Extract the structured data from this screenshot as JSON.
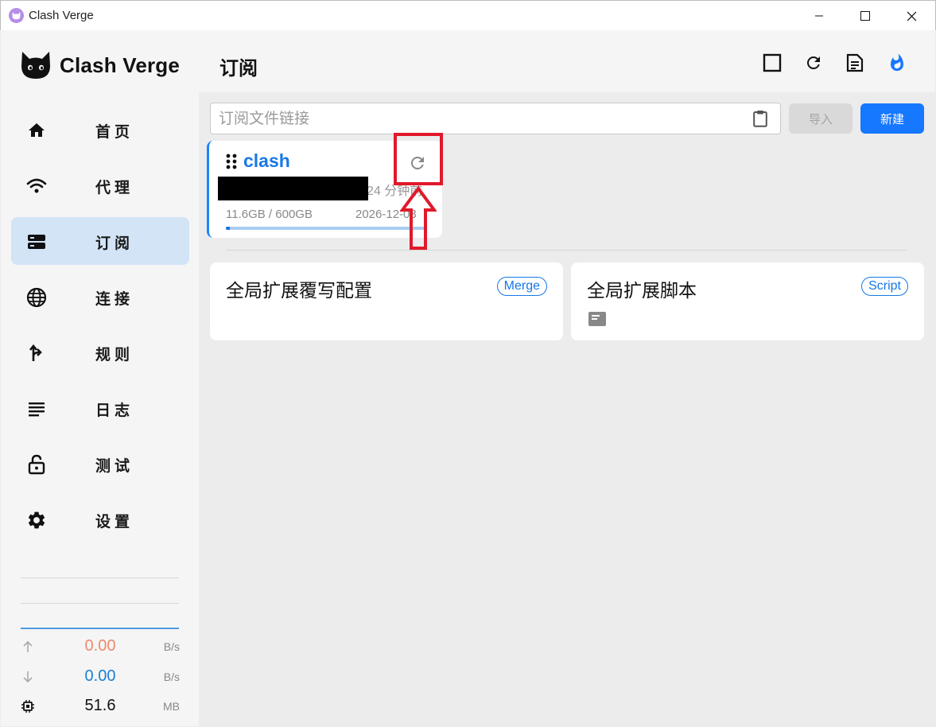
{
  "window": {
    "title": "Clash Verge"
  },
  "sidebar": {
    "brand": "Clash Verge",
    "items": [
      {
        "label": "首页",
        "icon": "home-icon",
        "active": false
      },
      {
        "label": "代理",
        "icon": "wifi-icon",
        "active": false
      },
      {
        "label": "订阅",
        "icon": "storage-icon",
        "active": true
      },
      {
        "label": "连接",
        "icon": "globe-icon",
        "active": false
      },
      {
        "label": "规则",
        "icon": "fork-arrow-icon",
        "active": false
      },
      {
        "label": "日志",
        "icon": "list-lines-icon",
        "active": false
      },
      {
        "label": "测试",
        "icon": "lock-open-icon",
        "active": false
      },
      {
        "label": "设置",
        "icon": "gear-icon",
        "active": false
      }
    ],
    "traffic": {
      "upload": {
        "value": "0.00",
        "unit": "B/s",
        "color": "#ee8a6a"
      },
      "download": {
        "value": "0.00",
        "unit": "B/s",
        "color": "#1a7fd4"
      },
      "memory": {
        "value": "51.6",
        "unit": "MB",
        "color": "#111111"
      }
    }
  },
  "main": {
    "title": "订阅",
    "header_icons": [
      "square-icon",
      "refresh-icon",
      "document-icon",
      "fire-icon"
    ],
    "url_input": {
      "placeholder": "订阅文件链接",
      "value": ""
    },
    "import_label": "导入",
    "new_label": "新建",
    "profile": {
      "name": "clash",
      "updated": "24 分钟前",
      "usage": "11.6GB / 600GB",
      "expire": "2026-12-03",
      "usage_fraction": 0.0193
    },
    "extensions": [
      {
        "title": "全局扩展覆写配置",
        "badge": "Merge"
      },
      {
        "title": "全局扩展脚本",
        "badge": "Script"
      }
    ]
  },
  "colors": {
    "accent": "#1677ff",
    "active_nav": "#d2e4f6",
    "highlight": "#e0192b"
  }
}
